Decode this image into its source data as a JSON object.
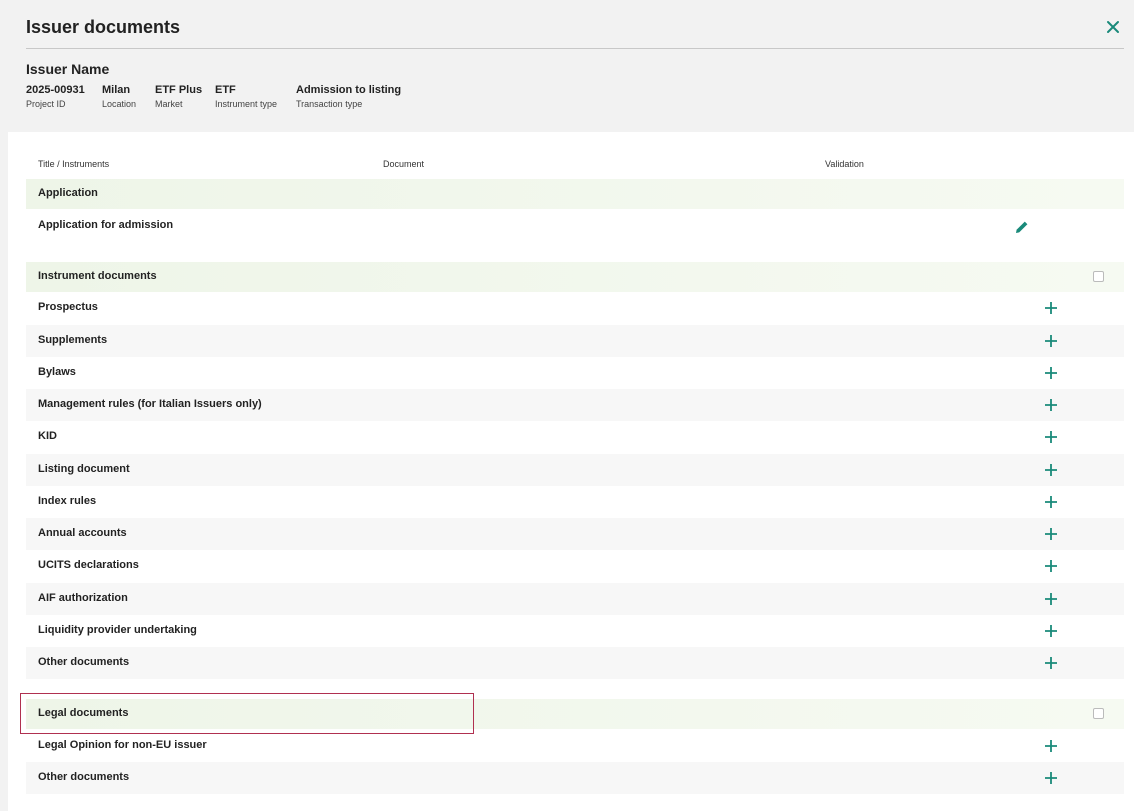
{
  "dialog": {
    "title": "Issuer documents"
  },
  "issuer": {
    "name": "Issuer Name",
    "fields": [
      {
        "value": "2025-00931",
        "key": "Project ID"
      },
      {
        "value": "Milan",
        "key": "Location"
      },
      {
        "value": "ETF Plus",
        "key": "Market"
      },
      {
        "value": "ETF",
        "key": "Instrument type"
      },
      {
        "value": "Admission to listing",
        "key": "Transaction type"
      }
    ]
  },
  "table": {
    "headers": {
      "title": "Title / Instruments",
      "document": "Document",
      "validation": "Validation"
    },
    "groups": [
      {
        "label": "Application",
        "items": [
          {
            "label": "Application for admission",
            "action": "edit-icon"
          }
        ]
      },
      {
        "label": "Instrument documents",
        "items": [
          {
            "label": "Prospectus"
          },
          {
            "label": "Supplements"
          },
          {
            "label": "Bylaws"
          },
          {
            "label": "Management rules (for Italian Issuers only)"
          },
          {
            "label": "KID"
          },
          {
            "label": "Listing document"
          },
          {
            "label": "Index rules"
          },
          {
            "label": "Annual accounts"
          },
          {
            "label": "UCITS declarations"
          },
          {
            "label": "AIF authorization"
          },
          {
            "label": "Liquidity provider undertaking"
          },
          {
            "label": "Other documents"
          }
        ]
      },
      {
        "label": "Legal documents",
        "items": [
          {
            "label": "Legal Opinion for non-EU issuer"
          },
          {
            "label": "Other documents"
          }
        ]
      }
    ]
  },
  "colors": {
    "accent": "#1a8a7a",
    "highlight_border": "#b03050",
    "group_bg": "#eef5e8"
  }
}
